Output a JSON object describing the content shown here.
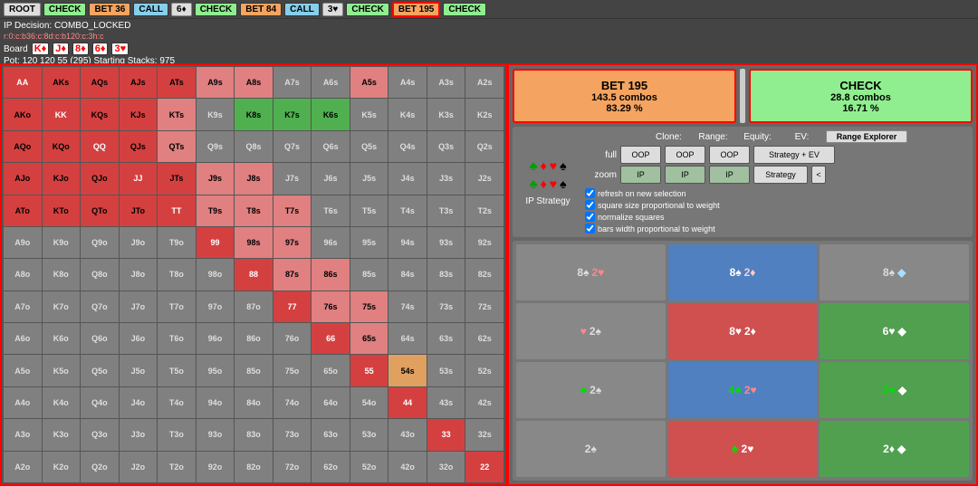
{
  "topBar": {
    "buttons": [
      {
        "label": "ROOT",
        "type": "default"
      },
      {
        "label": "CHECK",
        "type": "check"
      },
      {
        "label": "BET 36",
        "type": "bet"
      },
      {
        "label": "CALL",
        "type": "call"
      },
      {
        "label": "6♦",
        "type": "default"
      },
      {
        "label": "CHECK",
        "type": "check"
      },
      {
        "label": "BET 84",
        "type": "bet"
      },
      {
        "label": "CALL",
        "type": "call"
      },
      {
        "label": "3♥",
        "type": "default"
      },
      {
        "label": "CHECK",
        "type": "check"
      },
      {
        "label": "BET 195",
        "type": "bet-active"
      },
      {
        "label": "CHECK",
        "type": "check-bottom"
      }
    ]
  },
  "infoBar": {
    "ipDecision": "IP Decision: COMBO_LOCKED",
    "treePath": "r:0:c:b36:c:8d:c:b120:c:3h:c",
    "board": {
      "label": "Board",
      "cards": [
        {
          "rank": "K",
          "suit": "♦",
          "suitType": "diamond"
        },
        {
          "rank": "J",
          "suit": "♦",
          "suitType": "diamond"
        },
        {
          "rank": "8",
          "suit": "♦",
          "suitType": "diamond"
        },
        {
          "rank": "6",
          "suit": "♦",
          "suitType": "diamond"
        },
        {
          "rank": "3",
          "suit": "♥",
          "suitType": "heart"
        }
      ]
    },
    "pot": "Pot: 120 120 55 (295) Starting Stacks: 975"
  },
  "actions": {
    "bet": {
      "label": "BET 195",
      "combos": "143.5 combos",
      "pct": "83.29 %"
    },
    "check": {
      "label": "CHECK",
      "combos": "28.8 combos",
      "pct": "16.71 %"
    }
  },
  "controls": {
    "clone": "Clone:",
    "range": "Range:",
    "equity": "Equity:",
    "ev": "EV:",
    "rangeExplorer": "Range Explorer",
    "strategyEV": "Strategy + EV",
    "strategy": "Strategy",
    "full": "full",
    "zoom": "zoom",
    "oop1": "OOP",
    "oop2": "OOP",
    "oop3": "OOP",
    "ip1": "IP",
    "ip2": "IP",
    "ip3": "IP",
    "chevron": "<",
    "checkboxes": [
      "refresh on new selection",
      "square size proportional to weight",
      "normalize squares",
      "bars width proportional to weight"
    ]
  },
  "ipStrategyLabel": "IP Strategy",
  "matrix": {
    "rows": [
      [
        "AA",
        "AKs",
        "AQs",
        "AJs",
        "ATs",
        "A9s",
        "A8s",
        "A7s",
        "A6s",
        "A5s",
        "A4s",
        "A3s",
        "A2s"
      ],
      [
        "AKo",
        "KK",
        "KQs",
        "KJs",
        "KTs",
        "K9s",
        "K8s",
        "K7s",
        "K6s",
        "K5s",
        "K4s",
        "K3s",
        "K2s"
      ],
      [
        "AQo",
        "KQo",
        "QQ",
        "QJs",
        "QTs",
        "Q9s",
        "Q8s",
        "Q7s",
        "Q6s",
        "Q5s",
        "Q4s",
        "Q3s",
        "Q2s"
      ],
      [
        "AJo",
        "KJo",
        "QJo",
        "JJ",
        "JTs",
        "J9s",
        "J8s",
        "J7s",
        "J6s",
        "J5s",
        "J4s",
        "J3s",
        "J2s"
      ],
      [
        "ATo",
        "KTo",
        "QTo",
        "JTo",
        "TT",
        "T9s",
        "T8s",
        "T7s",
        "T6s",
        "T5s",
        "T4s",
        "T3s",
        "T2s"
      ],
      [
        "A9o",
        "K9o",
        "Q9o",
        "J9o",
        "T9o",
        "99",
        "98s",
        "97s",
        "96s",
        "95s",
        "94s",
        "93s",
        "92s"
      ],
      [
        "A8o",
        "K8o",
        "Q8o",
        "J8o",
        "T8o",
        "98o",
        "88",
        "87s",
        "86s",
        "85s",
        "84s",
        "83s",
        "82s"
      ],
      [
        "A7o",
        "K7o",
        "Q7o",
        "J7o",
        "T7o",
        "97o",
        "87o",
        "77",
        "76s",
        "75s",
        "74s",
        "73s",
        "72s"
      ],
      [
        "A6o",
        "K6o",
        "Q6o",
        "J6o",
        "T6o",
        "96o",
        "86o",
        "76o",
        "66",
        "65s",
        "64s",
        "63s",
        "62s"
      ],
      [
        "A5o",
        "K5o",
        "Q5o",
        "J5o",
        "T5o",
        "95o",
        "85o",
        "75o",
        "65o",
        "55",
        "54s",
        "53s",
        "52s"
      ],
      [
        "A4o",
        "K4o",
        "Q4o",
        "J4o",
        "T4o",
        "94o",
        "84o",
        "74o",
        "64o",
        "54o",
        "44",
        "43s",
        "42s"
      ],
      [
        "A3o",
        "K3o",
        "Q3o",
        "J3o",
        "T3o",
        "93o",
        "83o",
        "73o",
        "63o",
        "53o",
        "43o",
        "33",
        "32s"
      ],
      [
        "A2o",
        "K2o",
        "Q2o",
        "J2o",
        "T2o",
        "92o",
        "82o",
        "72o",
        "62o",
        "52o",
        "42o",
        "32o",
        "22"
      ]
    ],
    "colors": [
      [
        "red",
        "red",
        "red",
        "red",
        "red",
        "salmon",
        "salmon",
        "gray",
        "gray",
        "salmon",
        "gray",
        "gray",
        "gray"
      ],
      [
        "red",
        "red",
        "red",
        "red",
        "salmon",
        "gray",
        "green",
        "gray",
        "gray",
        "gray",
        "gray",
        "gray",
        "gray"
      ],
      [
        "red",
        "red",
        "red",
        "red",
        "salmon",
        "gray",
        "gray",
        "gray",
        "gray",
        "gray",
        "gray",
        "gray",
        "gray"
      ],
      [
        "red",
        "red",
        "red",
        "red",
        "red",
        "salmon",
        "salmon",
        "gray",
        "gray",
        "gray",
        "gray",
        "gray",
        "gray"
      ],
      [
        "red",
        "red",
        "red",
        "red",
        "red",
        "salmon",
        "salmon",
        "salmon",
        "gray",
        "gray",
        "gray",
        "gray",
        "gray"
      ],
      [
        "gray",
        "gray",
        "gray",
        "gray",
        "gray",
        "red",
        "salmon",
        "salmon",
        "gray",
        "gray",
        "gray",
        "gray",
        "gray"
      ],
      [
        "gray",
        "gray",
        "gray",
        "gray",
        "gray",
        "gray",
        "red",
        "salmon",
        "salmon",
        "gray",
        "gray",
        "gray",
        "gray"
      ],
      [
        "gray",
        "gray",
        "gray",
        "gray",
        "gray",
        "gray",
        "gray",
        "red",
        "salmon",
        "salmon",
        "gray",
        "gray",
        "gray"
      ],
      [
        "gray",
        "gray",
        "gray",
        "gray",
        "gray",
        "gray",
        "gray",
        "gray",
        "red",
        "salmon",
        "gray",
        "gray",
        "gray"
      ],
      [
        "gray",
        "gray",
        "gray",
        "gray",
        "gray",
        "gray",
        "gray",
        "gray",
        "gray",
        "red",
        "salmon-red",
        "gray",
        "gray"
      ],
      [
        "gray",
        "gray",
        "gray",
        "gray",
        "gray",
        "gray",
        "gray",
        "gray",
        "gray",
        "gray",
        "red",
        "gray",
        "gray"
      ],
      [
        "gray",
        "gray",
        "gray",
        "gray",
        "gray",
        "gray",
        "gray",
        "gray",
        "gray",
        "gray",
        "gray",
        "red",
        "gray"
      ],
      [
        "gray",
        "gray",
        "gray",
        "gray",
        "gray",
        "gray",
        "gray",
        "gray",
        "gray",
        "gray",
        "gray",
        "gray",
        "red"
      ]
    ]
  },
  "cardGrid": [
    [
      {
        "label": "8♠ 2♥",
        "color": "gray"
      },
      {
        "label": "8♠ 2♦",
        "color": "blue"
      },
      {
        "label": "8♠ ♦",
        "color": "gray"
      }
    ],
    [
      {
        "label": "♥ 2♠",
        "color": "gray"
      },
      {
        "label": "8♥ 2♦",
        "color": "red"
      },
      {
        "label": "6♥ ♦",
        "color": "green"
      }
    ],
    [
      {
        "label": "♣ 2♠",
        "color": "gray"
      },
      {
        "label": "4♣ 2♥",
        "color": "blue"
      },
      {
        "label": "2♣ ♦",
        "color": "green"
      }
    ],
    [
      {
        "label": "2♠",
        "color": "gray"
      },
      {
        "label": "♣ 2♥",
        "color": "red"
      },
      {
        "label": "2♦ ♦",
        "color": "green"
      }
    ]
  ]
}
